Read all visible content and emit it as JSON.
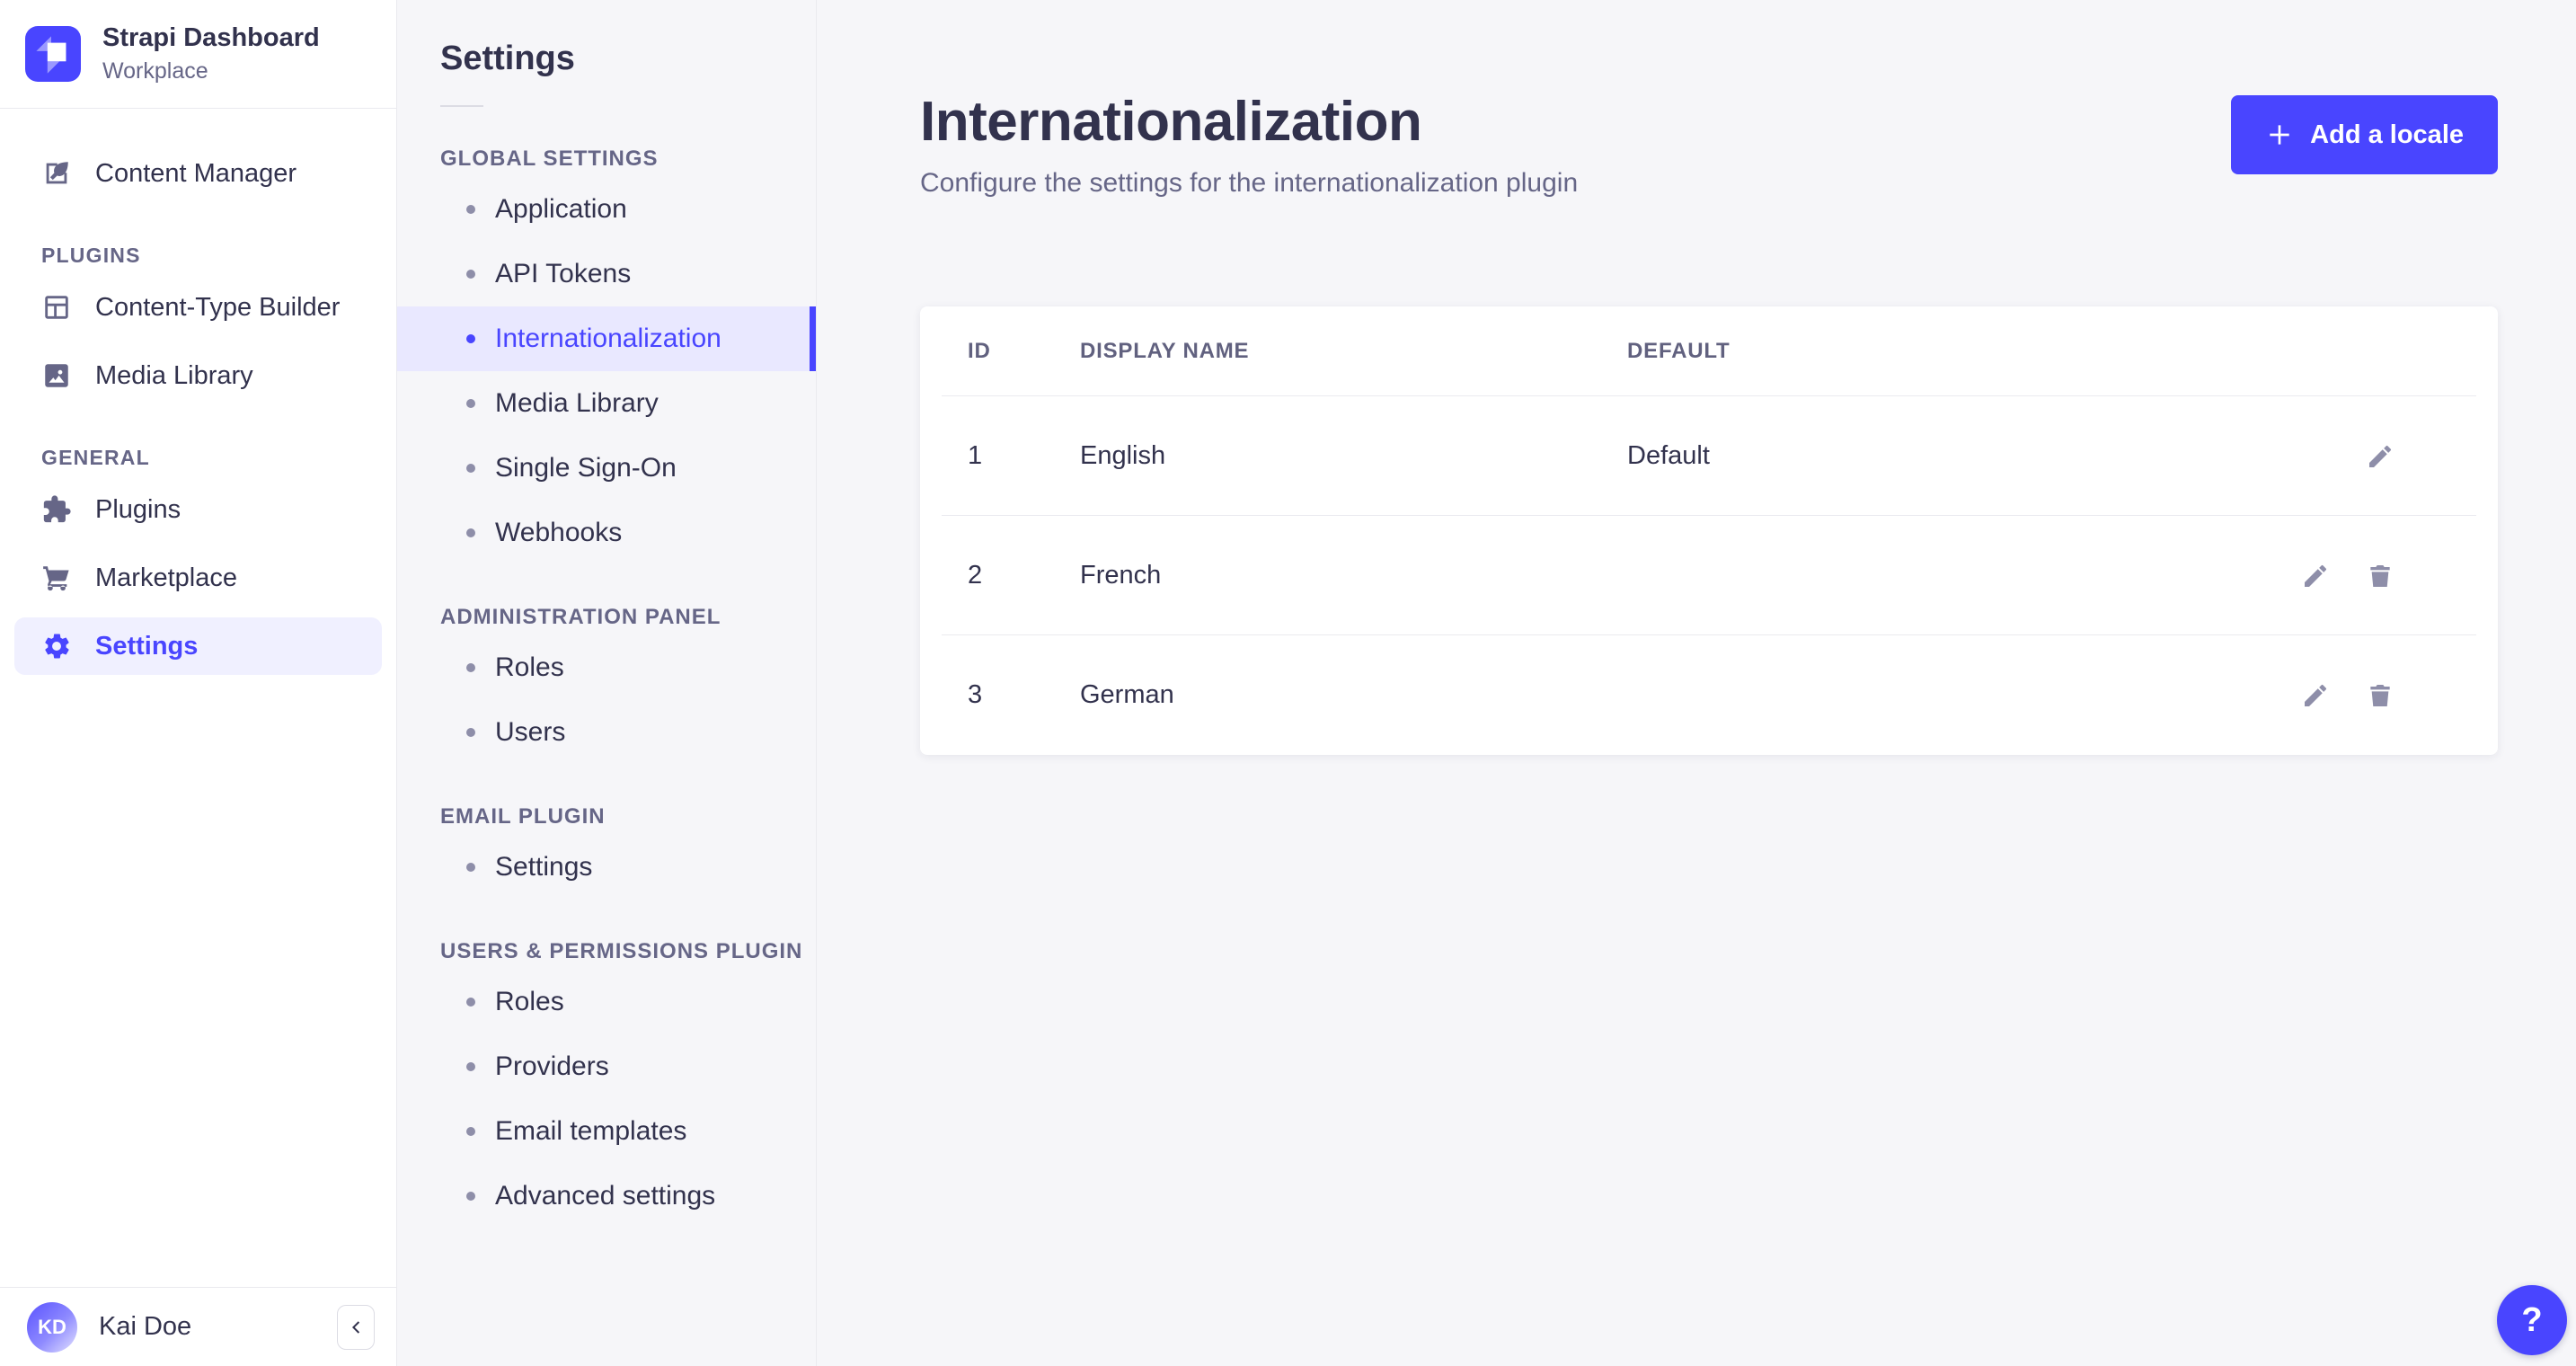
{
  "colors": {
    "primary": "#4945ff",
    "primary_light_bg": "#f0f0ff",
    "subnav_active_bg": "#e9e8ff",
    "text_main": "#32324d",
    "text_muted": "#666687",
    "icon_muted": "#8e8ea9",
    "border": "#eaeaef",
    "page_bg": "#f6f6f9"
  },
  "app": {
    "brand": {
      "title": "Strapi Dashboard",
      "subtitle": "Workplace",
      "logo": "strapi-logo-icon"
    },
    "user": {
      "name": "Kai Doe",
      "initials": "KD"
    }
  },
  "sidebar": {
    "sections": [
      {
        "label": "",
        "items": [
          {
            "label": "Content Manager",
            "icon": "content-manager-icon",
            "active": false
          }
        ]
      },
      {
        "label": "PLUGINS",
        "items": [
          {
            "label": "Content-Type Builder",
            "icon": "content-type-builder-icon",
            "active": false
          },
          {
            "label": "Media Library",
            "icon": "media-library-icon",
            "active": false
          }
        ]
      },
      {
        "label": "GENERAL",
        "items": [
          {
            "label": "Plugins",
            "icon": "plugins-icon",
            "active": false
          },
          {
            "label": "Marketplace",
            "icon": "marketplace-icon",
            "active": false
          },
          {
            "label": "Settings",
            "icon": "settings-icon",
            "active": true
          }
        ]
      }
    ]
  },
  "subnav": {
    "title": "Settings",
    "sections": [
      {
        "label": "GLOBAL SETTINGS",
        "items": [
          {
            "label": "Application",
            "active": false
          },
          {
            "label": "API Tokens",
            "active": false
          },
          {
            "label": "Internationalization",
            "active": true
          },
          {
            "label": "Media Library",
            "active": false
          },
          {
            "label": "Single Sign-On",
            "active": false
          },
          {
            "label": "Webhooks",
            "active": false
          }
        ]
      },
      {
        "label": "ADMINISTRATION PANEL",
        "items": [
          {
            "label": "Roles",
            "active": false
          },
          {
            "label": "Users",
            "active": false
          }
        ]
      },
      {
        "label": "EMAIL PLUGIN",
        "items": [
          {
            "label": "Settings",
            "active": false
          }
        ]
      },
      {
        "label": "USERS & PERMISSIONS PLUGIN",
        "items": [
          {
            "label": "Roles",
            "active": false
          },
          {
            "label": "Providers",
            "active": false
          },
          {
            "label": "Email templates",
            "active": false
          },
          {
            "label": "Advanced settings",
            "active": false
          }
        ]
      }
    ]
  },
  "main": {
    "title": "Internationalization",
    "subtitle": "Configure the settings for the internationalization plugin",
    "add_button": {
      "label": "Add a locale",
      "icon": "plus-icon"
    },
    "table": {
      "columns": [
        "ID",
        "DISPLAY NAME",
        "DEFAULT"
      ],
      "rows": [
        {
          "id": "1",
          "display_name": "English",
          "default": "Default",
          "actions": [
            "edit"
          ]
        },
        {
          "id": "2",
          "display_name": "French",
          "default": "",
          "actions": [
            "edit",
            "delete"
          ]
        },
        {
          "id": "3",
          "display_name": "German",
          "default": "",
          "actions": [
            "edit",
            "delete"
          ]
        }
      ]
    },
    "help_button": "?"
  }
}
